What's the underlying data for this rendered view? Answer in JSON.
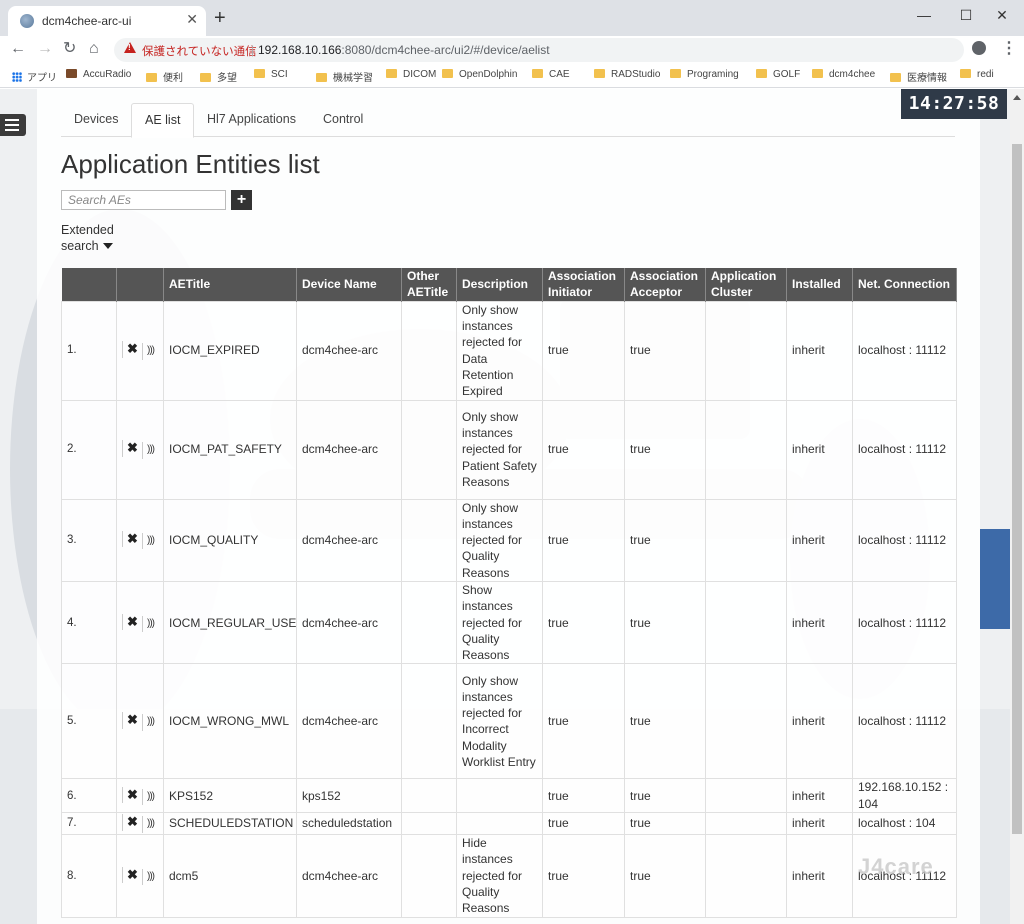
{
  "browser": {
    "tab_title": "dcm4chee-arc-ui",
    "tab_close": "✕",
    "new_tab": "+",
    "win_minimize": "—",
    "win_maximize": "☐",
    "win_close": "✕",
    "security_warning": "保護されていない通信",
    "url_host": "192.168.10.166",
    "url_rest": ":8080/dcm4chee-arc/ui2/#/device/aelist",
    "bookmarks": [
      {
        "label": "アプリ",
        "icon": "apps-grid-icon"
      },
      {
        "label": "AccuRadio",
        "icon": "accuradio-icon"
      },
      {
        "label": "便利",
        "icon": "folder-icon"
      },
      {
        "label": "多望",
        "icon": "folder-icon"
      },
      {
        "label": "SCI",
        "icon": "folder-icon"
      },
      {
        "label": "機械学習",
        "icon": "folder-icon"
      },
      {
        "label": "DICOM",
        "icon": "folder-icon"
      },
      {
        "label": "OpenDolphin",
        "icon": "folder-icon"
      },
      {
        "label": "CAE",
        "icon": "folder-icon"
      },
      {
        "label": "RADStudio",
        "icon": "folder-icon"
      },
      {
        "label": "Programing",
        "icon": "folder-icon"
      },
      {
        "label": "GOLF",
        "icon": "folder-icon"
      },
      {
        "label": "dcm4chee",
        "icon": "folder-icon"
      },
      {
        "label": "医療情報",
        "icon": "folder-icon"
      },
      {
        "label": "redi",
        "icon": "folder-icon"
      }
    ]
  },
  "clock": "14:27:58",
  "tabs": [
    {
      "label": "Devices",
      "active": false
    },
    {
      "label": "AE list",
      "active": true
    },
    {
      "label": "Hl7 Applications",
      "active": false
    },
    {
      "label": "Control",
      "active": false
    }
  ],
  "title": "Application Entities list",
  "search": {
    "placeholder": "Search AEs",
    "add_label": "+"
  },
  "extended_search": {
    "line1": "Extended",
    "line2": "search"
  },
  "table": {
    "columns": [
      "AETitle",
      "Device Name",
      "Other AETitle",
      "Description",
      "Association Initiator",
      "Association Acceptor",
      "Application Cluster",
      "Installed",
      "Net. Connection"
    ],
    "delete_glyph": "✖",
    "echo_glyph": "))) ",
    "rows": [
      {
        "num": "1.",
        "aetitle": "IOCM_EXPIRED",
        "device": "dcm4chee-arc",
        "other": "",
        "description": "Only show instances rejected for Data Retention Expired",
        "initiator": "true",
        "acceptor": "true",
        "cluster": "",
        "installed": "inherit",
        "connection": "localhost : 11112"
      },
      {
        "num": "2.",
        "aetitle": "IOCM_PAT_SAFETY",
        "device": "dcm4chee-arc",
        "other": "",
        "description": "Only show instances rejected for Patient Safety Reasons",
        "initiator": "true",
        "acceptor": "true",
        "cluster": "",
        "installed": "inherit",
        "connection": "localhost : 11112"
      },
      {
        "num": "3.",
        "aetitle": "IOCM_QUALITY",
        "device": "dcm4chee-arc",
        "other": "",
        "description": "Only show instances rejected for Quality Reasons",
        "initiator": "true",
        "acceptor": "true",
        "cluster": "",
        "installed": "inherit",
        "connection": "localhost : 11112"
      },
      {
        "num": "4.",
        "aetitle": "IOCM_REGULAR_USE",
        "device": "dcm4chee-arc",
        "other": "",
        "description": "Show instances rejected for Quality Reasons",
        "initiator": "true",
        "acceptor": "true",
        "cluster": "",
        "installed": "inherit",
        "connection": "localhost : 11112"
      },
      {
        "num": "5.",
        "aetitle": "IOCM_WRONG_MWL",
        "device": "dcm4chee-arc",
        "other": "",
        "description": "Only show instances rejected for Incorrect Modality Worklist Entry",
        "initiator": "true",
        "acceptor": "true",
        "cluster": "",
        "installed": "inherit",
        "connection": "localhost : 11112"
      },
      {
        "num": "6.",
        "aetitle": "KPS152",
        "device": "kps152",
        "other": "",
        "description": "",
        "initiator": "true",
        "acceptor": "true",
        "cluster": "",
        "installed": "inherit",
        "connection": "192.168.10.152 : 104"
      },
      {
        "num": "7.",
        "aetitle": "SCHEDULEDSTATION",
        "device": "scheduledstation",
        "other": "",
        "description": "",
        "initiator": "true",
        "acceptor": "true",
        "cluster": "",
        "installed": "inherit",
        "connection": "localhost : 104"
      },
      {
        "num": "8.",
        "aetitle": "dcm5",
        "device": "dcm4chee-arc",
        "other": "",
        "description": "Hide instances rejected for Quality Reasons",
        "initiator": "true",
        "acceptor": "true",
        "cluster": "",
        "installed": "inherit",
        "connection": "localhost : 11112"
      }
    ]
  },
  "watermark": "J4care"
}
